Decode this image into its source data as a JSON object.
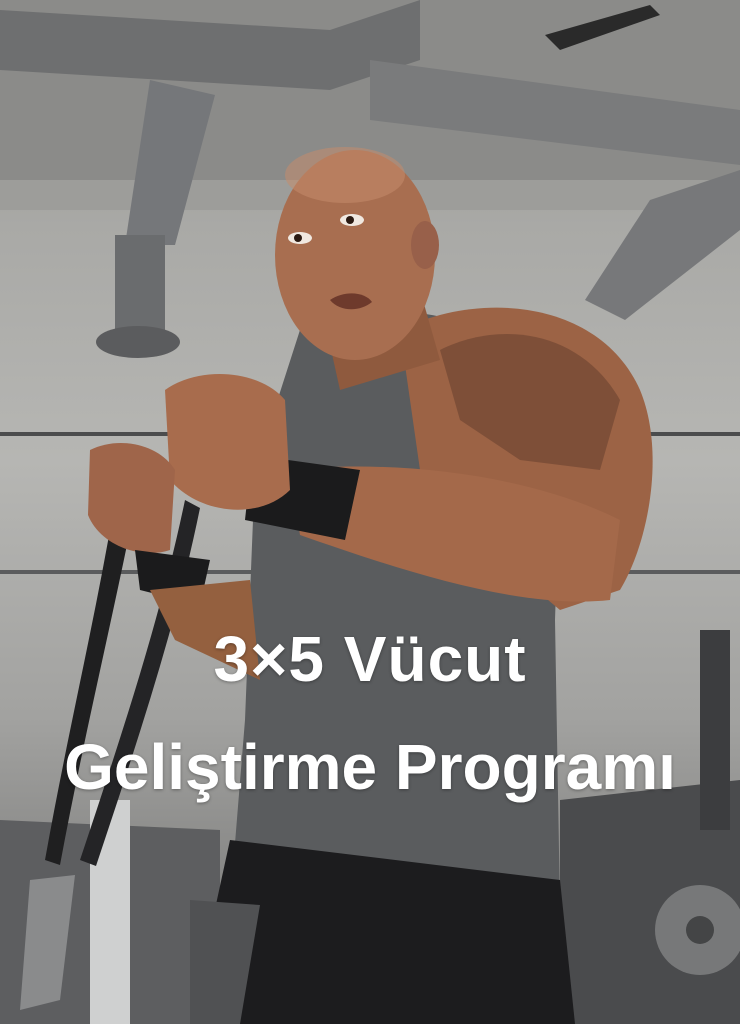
{
  "caption": {
    "line1": "3×5 Vücut",
    "line2": "Geliştirme Programı"
  },
  "colors": {
    "caption_text": "#ffffff",
    "tank_top": "#5a5c5e",
    "wall": "#b6b6b3",
    "skin": "#a4694a"
  }
}
